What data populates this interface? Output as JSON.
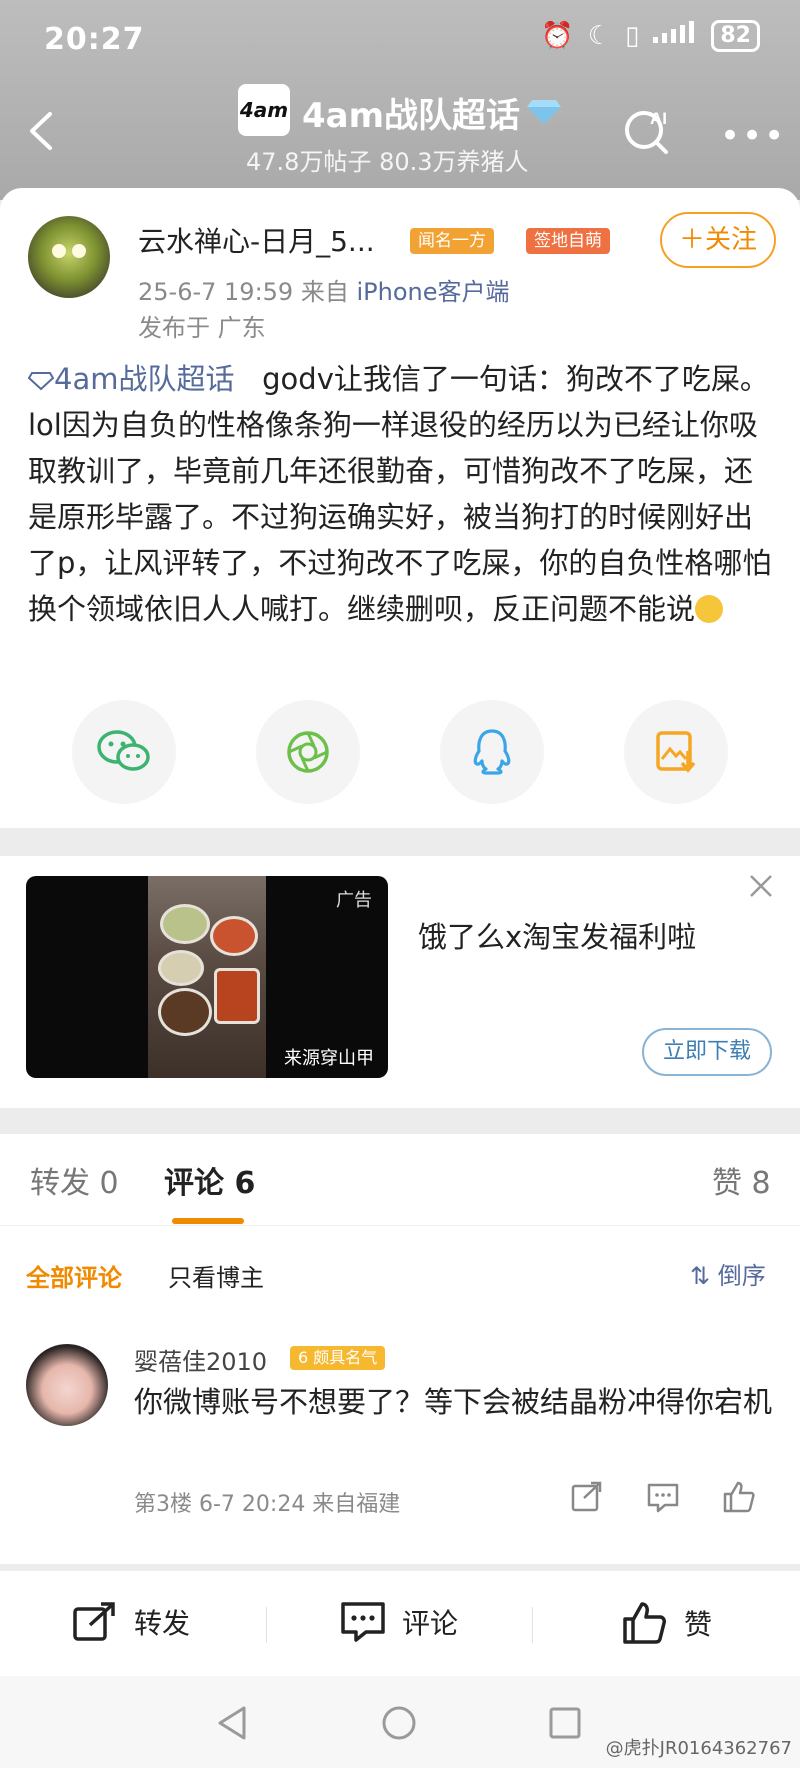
{
  "status_bar": {
    "time": "20:27",
    "battery": "82",
    "icons": [
      "alarm-icon",
      "moon-icon",
      "vibrate-icon",
      "signal-icon",
      "battery-icon"
    ]
  },
  "topic": {
    "logo_text": "4am",
    "title": "4am战队超话",
    "subtitle": "47.8万帖子 80.3万养猪人"
  },
  "post": {
    "author": "云水禅心-日月_5...",
    "badges": [
      "闻名一方",
      "签地自萌"
    ],
    "follow_label": "＋关注",
    "date": "25-6-7 19:59",
    "from_label": "来自",
    "source": "iPhone客户端",
    "location": "发布于 广东",
    "topic_tag": "4am战队超话",
    "text": "godv让我信了一句话：狗改不了吃屎。lol因为自负的性格像条狗一样退役的经历以为已经让你吸取教训了，毕竟前几年还很勤奋，可惜狗改不了吃屎，还是原形毕露了。不过狗运确实好，被当狗打的时候刚好出了p，让风评转了，不过狗改不了吃屎，你的自负性格哪怕换个领域依旧人人喊打。继续删呗，反正问题不能说",
    "share_targets": [
      "wechat-icon",
      "moments-icon",
      "qq-icon",
      "save-image-icon"
    ]
  },
  "ad": {
    "label": "广告",
    "source": "来源穿山甲",
    "text": "饿了么x淘宝发福利啦",
    "cta": "立即下载",
    "colors": {
      "cta_border": "#8ab4d6",
      "cta_text": "#3f7db3"
    }
  },
  "tabs": {
    "repost": "转发 0",
    "comment": "评论 6",
    "like": "赞 8"
  },
  "filters": {
    "all": "全部评论",
    "author_only": "只看博主",
    "sort": "倒序"
  },
  "comment": {
    "user": "婴蓓佳2010",
    "badge": "颇具名气",
    "badge_level": "6",
    "text": "你微博账号不想要了？等下会被结晶粉冲得你宕机",
    "meta": "第3楼 6-7 20:24 来自福建"
  },
  "bottom_bar": {
    "repost": "转发",
    "comment": "评论",
    "like": "赞"
  },
  "watermark": "@虎扑JR0164362767",
  "colors": {
    "accent": "#f08a00",
    "link": "#566b9c"
  }
}
